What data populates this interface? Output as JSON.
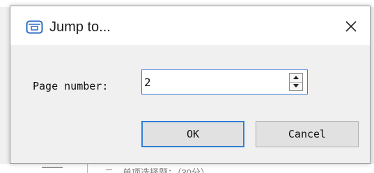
{
  "background": {
    "bottom_text": "二、单项选择题：（30分）"
  },
  "dialog": {
    "title": "Jump to...",
    "app_icon": "window-icon",
    "close_icon": "close-icon",
    "page_label": "Page number:",
    "page_value": "2",
    "ok_label": "OK",
    "cancel_label": "Cancel"
  },
  "colors": {
    "focus_border": "#3c78d8",
    "default_button_border": "#2f7fd6",
    "icon_blue": "#2b6cc4"
  }
}
